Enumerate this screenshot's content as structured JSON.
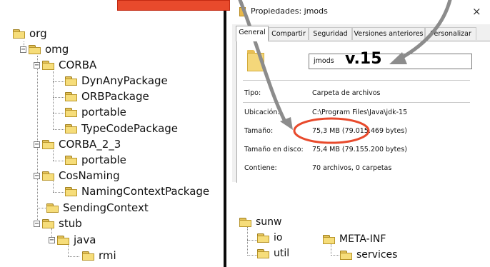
{
  "left_tree": {
    "items": [
      {
        "label": "org",
        "toggle": ""
      },
      {
        "label": "omg",
        "toggle": "−"
      },
      {
        "label": "CORBA",
        "toggle": "−"
      },
      {
        "label": "DynAnyPackage",
        "toggle": ""
      },
      {
        "label": "ORBPackage",
        "toggle": ""
      },
      {
        "label": "portable",
        "toggle": ""
      },
      {
        "label": "TypeCodePackage",
        "toggle": ""
      },
      {
        "label": "CORBA_2_3",
        "toggle": "−"
      },
      {
        "label": "portable",
        "toggle": ""
      },
      {
        "label": "CosNaming",
        "toggle": "−"
      },
      {
        "label": "NamingContextPackage",
        "toggle": ""
      },
      {
        "label": "SendingContext",
        "toggle": ""
      },
      {
        "label": "stub",
        "toggle": "−"
      },
      {
        "label": "java",
        "toggle": "−"
      },
      {
        "label": "rmi",
        "toggle": ""
      }
    ]
  },
  "dialog": {
    "title": "Propiedades: jmods",
    "close": "×",
    "tabs": [
      "General",
      "Compartir",
      "Seguridad",
      "Versiones anteriores",
      "Personalizar"
    ],
    "active_tab": "General",
    "folder_name": "jmods",
    "version_note": "v.15",
    "properties": [
      {
        "label": "Tipo:",
        "value": "Carpeta de archivos"
      },
      {
        "label": "Ubicación:",
        "value": "C:\\Program Files\\Java\\jdk-15"
      },
      {
        "label": "Tamaño:",
        "value": "75,3 MB (79.015.469 bytes)"
      },
      {
        "label": "Tamaño en disco:",
        "value": "75,4 MB (79.155.200 bytes)"
      },
      {
        "label": "Contiene:",
        "value": "70 archivos, 0 carpetas"
      }
    ]
  },
  "bottom_tree_a": {
    "items": [
      {
        "label": "sunw",
        "toggle": ""
      },
      {
        "label": "io",
        "toggle": ""
      },
      {
        "label": "util",
        "toggle": ""
      }
    ]
  },
  "bottom_tree_b": {
    "items": [
      {
        "label": "META-INF",
        "toggle": ""
      },
      {
        "label": "services",
        "toggle": ""
      }
    ]
  },
  "colors": {
    "annotation_red": "#e84a2c",
    "arrow_gray": "#8c8c8c",
    "folder_yellow": "#f6dd7a",
    "dialog_bg": "#f0f0f0"
  }
}
